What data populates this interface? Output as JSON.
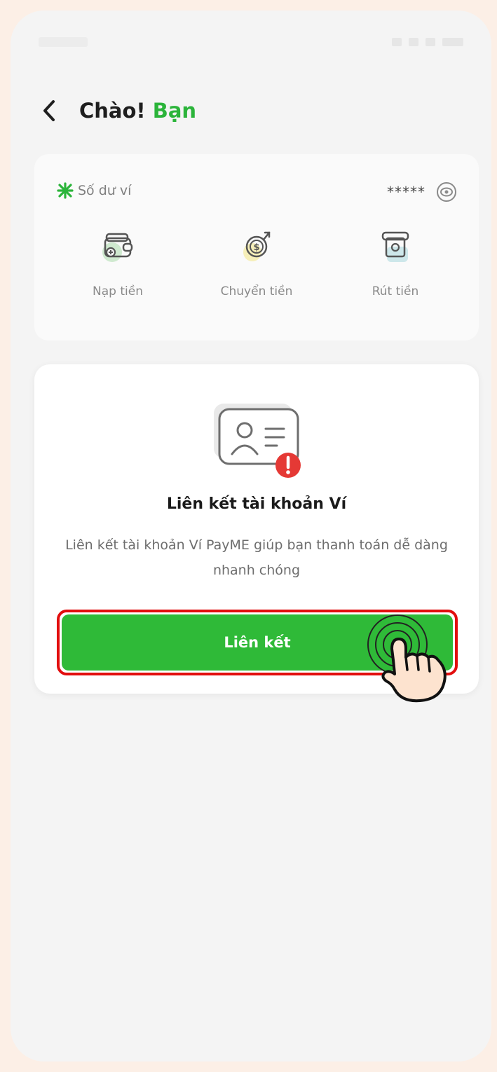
{
  "header": {
    "title_prefix": "Chào! ",
    "title_accent": "Bạn"
  },
  "wallet": {
    "label": "Số dư ví",
    "balance_masked": "*****",
    "actions": [
      {
        "label": "Nạp tiền",
        "icon": "wallet-topup-icon"
      },
      {
        "label": "Chuyển tiền",
        "icon": "money-transfer-icon"
      },
      {
        "label": "Rút tiền",
        "icon": "atm-withdraw-icon"
      }
    ]
  },
  "link_card": {
    "title": "Liên kết tài khoản Ví",
    "description": "Liên kết tài khoản Ví PayME giúp bạn thanh toán dễ dàng nhanh chóng",
    "button_label": "Liên kết"
  },
  "colors": {
    "accent": "#2bb43a",
    "button": "#2fba38",
    "highlight": "#e20e0e",
    "alert": "#e53935"
  }
}
